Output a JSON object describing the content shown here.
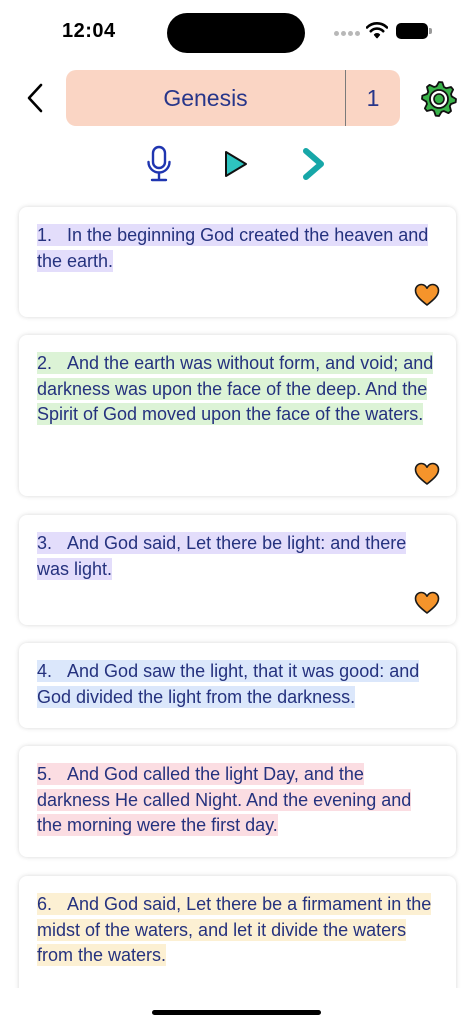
{
  "status_bar": {
    "time": "12:04"
  },
  "header": {
    "book": "Genesis",
    "chapter": "1"
  },
  "colors": {
    "text": "#25327e",
    "selector_bg": "#fad5c4",
    "heart": "#f5942b",
    "mic": "#1f35b0",
    "play": "#2ec4c0",
    "next": "#17a7a8"
  },
  "verses": [
    {
      "number": "1.",
      "text": "In the beginning God created the heaven and the earth.",
      "highlight": "#e3ddfb",
      "favorite": true
    },
    {
      "number": "2.",
      "text": "And the earth was without form, and void; and darkness was upon the face of the deep. And the Spirit of God moved upon the face of the waters.",
      "highlight": "#dcf3d6",
      "favorite": true
    },
    {
      "number": "3.",
      "text": "And God said, Let there be light: and there was light.",
      "highlight": "#e3ddfb",
      "favorite": true
    },
    {
      "number": "4.",
      "text": "And God saw the light, that it was good: and God divided the light from the darkness.",
      "highlight": "#dbe7fb",
      "favorite": false
    },
    {
      "number": "5.",
      "text": "And God called the light Day, and the darkness He called Night. And the evening and the morning were the first day.",
      "highlight": "#fbdde2",
      "favorite": false
    },
    {
      "number": "6.",
      "text": "And God said, Let there be a firmament in the midst of the waters, and let it divide the waters from the waters.",
      "highlight": "#fcf0d3",
      "favorite": false
    }
  ]
}
